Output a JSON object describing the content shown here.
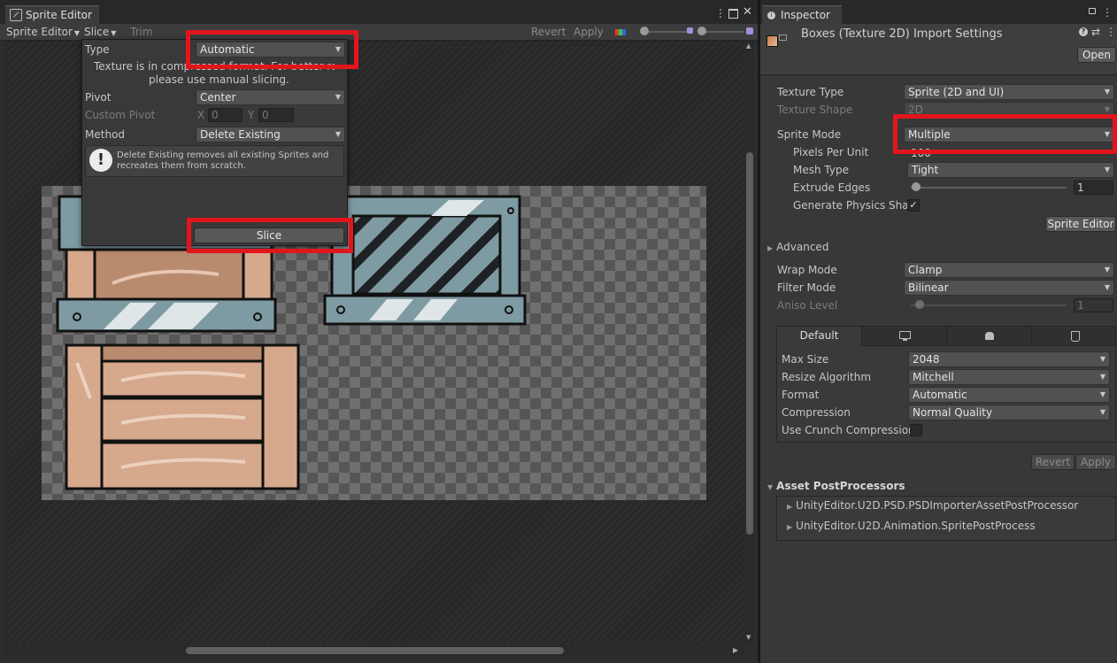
{
  "sprite_editor": {
    "tab_title": "Sprite Editor",
    "toolbar": {
      "menu_label": "Sprite Editor",
      "slice_label": "Slice",
      "trim_label": "Trim",
      "revert_label": "Revert",
      "apply_label": "Apply"
    },
    "slice_popup": {
      "type_label": "Type",
      "type_value": "Automatic",
      "info_text_line1": "Texture is in compressed format. For better result",
      "info_text_line2": "please use manual slicing.",
      "pivot_label": "Pivot",
      "pivot_value": "Center",
      "custom_pivot_label": "Custom Pivot",
      "x_label": "X",
      "x_value": "0",
      "y_label": "Y",
      "y_value": "0",
      "method_label": "Method",
      "method_value": "Delete Existing",
      "help_text": "Delete Existing removes all existing Sprites and recreates them from scratch.",
      "slice_button": "Slice"
    }
  },
  "inspector": {
    "tab_title": "Inspector",
    "header_title": "Boxes (Texture 2D) Import Settings",
    "open_button": "Open",
    "texture_type_label": "Texture Type",
    "texture_type_value": "Sprite (2D and UI)",
    "texture_shape_label": "Texture Shape",
    "texture_shape_value": "2D",
    "sprite_mode_label": "Sprite Mode",
    "sprite_mode_value": "Multiple",
    "pixels_per_unit_label": "Pixels Per Unit",
    "pixels_per_unit_value": "100",
    "mesh_type_label": "Mesh Type",
    "mesh_type_value": "Tight",
    "extrude_edges_label": "Extrude Edges",
    "extrude_edges_value": "1",
    "generate_physics_label": "Generate Physics Shap",
    "generate_physics_checked": true,
    "sprite_editor_button": "Sprite Editor",
    "advanced_label": "Advanced",
    "wrap_mode_label": "Wrap Mode",
    "wrap_mode_value": "Clamp",
    "filter_mode_label": "Filter Mode",
    "filter_mode_value": "Bilinear",
    "aniso_level_label": "Aniso Level",
    "aniso_level_value": "1",
    "platform_tabs": {
      "default_label": "Default",
      "icons": [
        "monitor-icon",
        "android-icon",
        "html5-icon"
      ]
    },
    "max_size_label": "Max Size",
    "max_size_value": "2048",
    "resize_algorithm_label": "Resize Algorithm",
    "resize_algorithm_value": "Mitchell",
    "format_label": "Format",
    "format_value": "Automatic",
    "compression_label": "Compression",
    "compression_value": "Normal Quality",
    "crunch_label": "Use Crunch Compression",
    "revert_button": "Revert",
    "apply_button": "Apply",
    "postprocessors_label": "Asset PostProcessors",
    "postprocessors": [
      "UnityEditor.U2D.PSD.PSDImporterAssetPostProcessor",
      "UnityEditor.U2D.Animation.SpritePostProcess"
    ]
  },
  "colors": {
    "highlight": "#e3151c",
    "panel_bg": "#383838",
    "canvas_bg": "#2b2b2b"
  }
}
